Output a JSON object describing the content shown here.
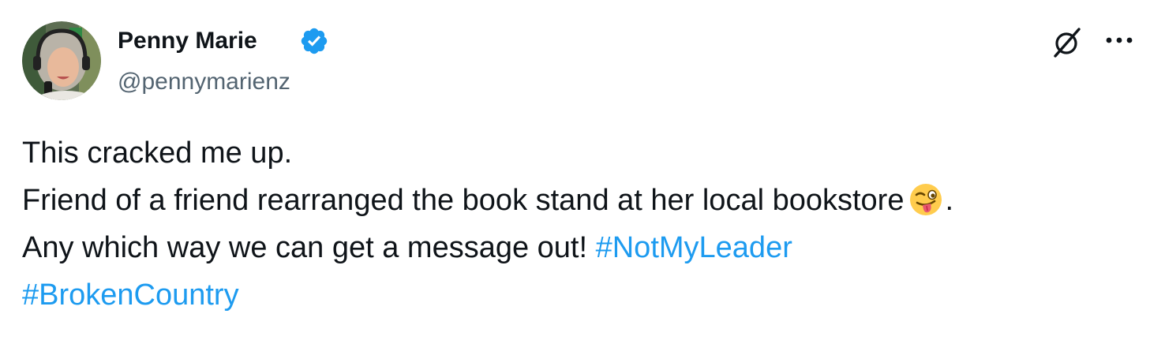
{
  "author": {
    "display_name": "Penny Marie",
    "handle": "@pennymarienz",
    "verified": true
  },
  "post": {
    "line1": "This cracked me up.",
    "line2_text": "Friend of a friend rearranged the book stand at her local bookstore",
    "line2_end": ".",
    "line3_text": "Any which way we can get a message out!",
    "hashtag1": "#NotMyLeader",
    "hashtag2": "#BrokenCountry",
    "emoji": "winking-face-with-tongue"
  },
  "icons": {
    "verified": "verified-badge-icon",
    "grok": "grok-icon",
    "more": "more-icon"
  },
  "colors": {
    "text": "#0f1419",
    "secondary": "#536471",
    "link": "#1d9bf0",
    "verified": "#1d9bf0"
  }
}
